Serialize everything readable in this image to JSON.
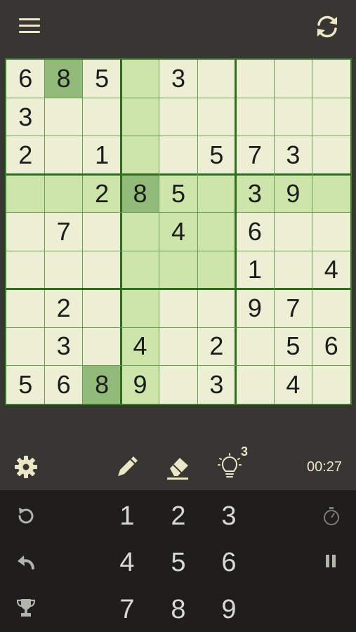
{
  "board": {
    "cells": [
      [
        "6",
        "8",
        "5",
        "",
        "3",
        "",
        "",
        "",
        ""
      ],
      [
        "3",
        "",
        "",
        "",
        "",
        "",
        "",
        "",
        ""
      ],
      [
        "2",
        "",
        "1",
        "",
        "",
        "5",
        "7",
        "3",
        ""
      ],
      [
        "",
        "",
        "2",
        "8",
        "5",
        "",
        "3",
        "9",
        ""
      ],
      [
        "",
        "7",
        "",
        "",
        "4",
        "",
        "6",
        "",
        ""
      ],
      [
        "",
        "",
        "",
        "",
        "",
        "",
        "1",
        "",
        "4"
      ],
      [
        "",
        "2",
        "",
        "",
        "",
        "",
        "9",
        "7",
        ""
      ],
      [
        "",
        "3",
        "",
        "4",
        "",
        "2",
        "",
        "5",
        "6"
      ],
      [
        "5",
        "6",
        "8",
        "9",
        "",
        "3",
        "",
        "4",
        ""
      ]
    ],
    "selected": [
      3,
      3
    ],
    "same_number": [
      [
        0,
        1
      ],
      [
        3,
        3
      ],
      [
        8,
        2
      ]
    ],
    "colors": {
      "highlight": "#cde4ab",
      "same_number": "#92bb7a",
      "cell": "#ecefd3"
    }
  },
  "toolbar": {
    "hints_remaining": "3",
    "timer": "00:27"
  },
  "keypad": {
    "digits": [
      "1",
      "2",
      "3",
      "4",
      "5",
      "6",
      "7",
      "8",
      "9"
    ]
  },
  "icons": {
    "menu": "menu-icon",
    "refresh": "refresh-icon",
    "settings": "gear-icon",
    "pencil": "pencil-icon",
    "eraser": "eraser-icon",
    "hint": "lightbulb-icon",
    "restart": "restart-icon",
    "undo": "undo-icon",
    "trophy": "trophy-icon",
    "stopwatch": "stopwatch-icon",
    "pause": "pause-icon"
  }
}
